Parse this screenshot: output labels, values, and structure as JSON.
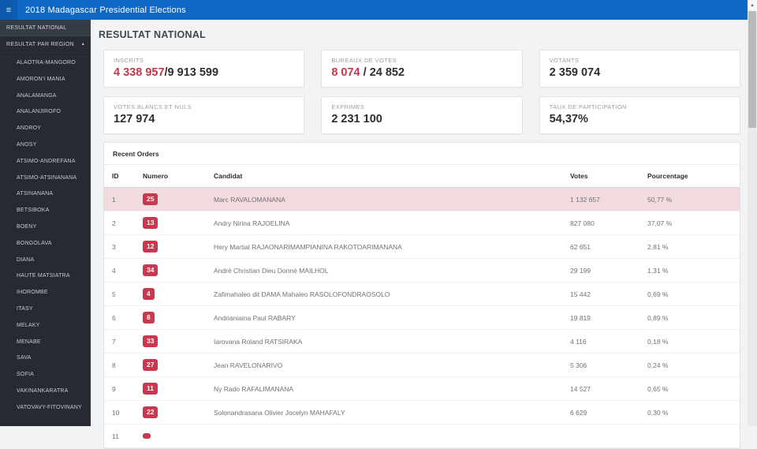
{
  "app": {
    "title": "2018 Madagascar Presidential Elections"
  },
  "icons": {
    "menu": "≡",
    "caret_up": "▴",
    "scroll_up": "▲"
  },
  "colors": {
    "header_blue": "#1068c5",
    "sidebar_bg": "#262a31",
    "accent_red": "#c4374a",
    "badge_red": "#c9384e",
    "row_highlight": "#f2dbde"
  },
  "sidebar": {
    "national_label": "RESULTAT NATIONAL",
    "par_region_label": "RESULTAT PAR REGION",
    "regions": [
      "ALAOTRA-MANGORO",
      "AMORON'I MANIA",
      "ANALAMANGA",
      "ANALANJIROFO",
      "ANDROY",
      "ANOSY",
      "ATSIMO-ANDREFANA",
      "ATSIMO-ATSINANANA",
      "ATSINANANA",
      "BETSIBOKA",
      "BOENY",
      "BONGOLAVA",
      "DIANA",
      "HAUTE MATSIATRA",
      "IHOROMBE",
      "ITASY",
      "MELAKY",
      "MENABE",
      "SAVA",
      "SOFIA",
      "VAKINANKARATRA",
      "VATOVAVY-FITOVINANY"
    ]
  },
  "main": {
    "heading": "RESULTAT NATIONAL",
    "cards": [
      {
        "label": "INSCRITS",
        "value_red": "4 338 957",
        "value_rest": "/9 913 599"
      },
      {
        "label": "BUREAUX DE VOTES",
        "value_red": "8 074",
        "value_rest": " / 24 852"
      },
      {
        "label": "VOTANTS",
        "value_red": "",
        "value_rest": "2 359 074"
      },
      {
        "label": "VOTES BLANCS ET NULS",
        "value_red": "",
        "value_rest": "127 974"
      },
      {
        "label": "EXPRIMES",
        "value_red": "",
        "value_rest": "2 231 100"
      },
      {
        "label": "TAUX DE PARTICIPATION",
        "value_red": "",
        "value_rest": "54,37%"
      }
    ],
    "table": {
      "title": "Recent Orders",
      "columns": [
        "ID",
        "Numero",
        "Candidat",
        "Votes",
        "Pourcentage"
      ],
      "rows": [
        {
          "id": "1",
          "numero": "25",
          "candidat": "Marc RAVALOMANANA",
          "votes": "1 132 657",
          "pourcentage": "50,77 %",
          "highlight": true
        },
        {
          "id": "2",
          "numero": "13",
          "candidat": "Andry Nirina RAJOELINA",
          "votes": "827 080",
          "pourcentage": "37,07 %",
          "highlight": false
        },
        {
          "id": "3",
          "numero": "12",
          "candidat": "Hery Martial RAJAONARIMAMPIANINA RAKOTOARIMANANA",
          "votes": "62 651",
          "pourcentage": "2,81 %",
          "highlight": false
        },
        {
          "id": "4",
          "numero": "34",
          "candidat": "André Christian Dieu Donné MAILHOL",
          "votes": "29 199",
          "pourcentage": "1,31 %",
          "highlight": false
        },
        {
          "id": "5",
          "numero": "4",
          "candidat": "Zafimahaleo dit DAMA Mahaleo RASOLOFONDRAOSOLO",
          "votes": "15 442",
          "pourcentage": "0,69 %",
          "highlight": false
        },
        {
          "id": "6",
          "numero": "8",
          "candidat": "Andrianiaina Paul RABARY",
          "votes": "19 819",
          "pourcentage": "0,89 %",
          "highlight": false
        },
        {
          "id": "7",
          "numero": "33",
          "candidat": "Iarovana Roland RATSIRAKA",
          "votes": "4 116",
          "pourcentage": "0,18 %",
          "highlight": false
        },
        {
          "id": "8",
          "numero": "27",
          "candidat": "Jean RAVELONARIVO",
          "votes": "5 306",
          "pourcentage": "0,24 %",
          "highlight": false
        },
        {
          "id": "9",
          "numero": "11",
          "candidat": "Ny Rado RAFALIMANANA",
          "votes": "14 527",
          "pourcentage": "0,65 %",
          "highlight": false
        },
        {
          "id": "10",
          "numero": "22",
          "candidat": "Solonandrasana Olivier Jocelyn MAHAFALY",
          "votes": "6 629",
          "pourcentage": "0,30 %",
          "highlight": false
        },
        {
          "id": "11",
          "numero": "",
          "candidat": "",
          "votes": "",
          "pourcentage": "",
          "highlight": false
        }
      ]
    }
  }
}
